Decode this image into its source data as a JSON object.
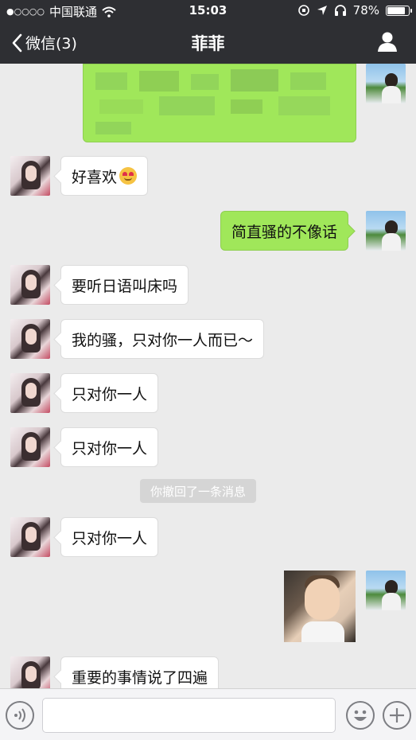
{
  "status_bar": {
    "carrier": "中国联通",
    "time": "15:03",
    "battery": "78%",
    "battery_level": 0.78
  },
  "nav": {
    "back_label": "微信(3)",
    "title": "菲菲"
  },
  "messages": {
    "m1": "好喜欢",
    "m2": "简直骚的不像话",
    "m3": "要听日语叫床吗",
    "m4": "我的骚，只对你一人而已～",
    "m5": "只对你一人",
    "m6": "只对你一人",
    "notice": "你撤回了一条消息",
    "m7": "只对你一人",
    "m8": "重要的事情说了四遍"
  },
  "colors": {
    "header_bg": "#2e2f33",
    "chat_bg": "#ebebeb",
    "outgoing_bubble": "#a0e75a",
    "incoming_bubble": "#ffffff"
  },
  "icons": {
    "wifi": "wifi-icon",
    "back": "chevron-left-icon",
    "profile": "person-icon",
    "voice": "voice-icon",
    "emoji": "emoji-icon",
    "more": "plus-icon"
  }
}
